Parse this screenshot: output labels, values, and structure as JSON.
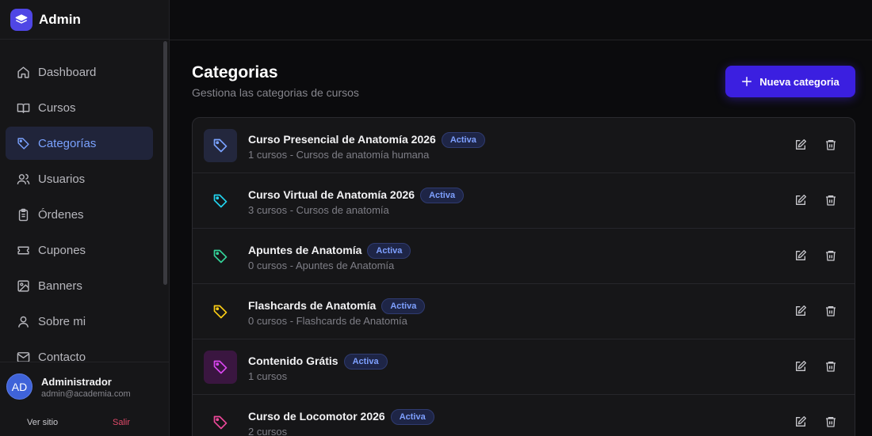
{
  "app": {
    "title": "Admin"
  },
  "sidebar": {
    "items": [
      {
        "label": "Dashboard",
        "icon": "home-icon"
      },
      {
        "label": "Cursos",
        "icon": "book-icon"
      },
      {
        "label": "Categorías",
        "icon": "tag-icon",
        "active": true
      },
      {
        "label": "Usuarios",
        "icon": "users-icon"
      },
      {
        "label": "Órdenes",
        "icon": "clipboard-icon"
      },
      {
        "label": "Cupones",
        "icon": "ticket-icon"
      },
      {
        "label": "Banners",
        "icon": "image-icon"
      },
      {
        "label": "Sobre mi",
        "icon": "user-icon"
      },
      {
        "label": "Contacto",
        "icon": "mail-icon"
      }
    ]
  },
  "user": {
    "initials": "AD",
    "name": "Administrador",
    "email": "admin@academia.com",
    "view_site": "Ver sitio",
    "logout": "Salir"
  },
  "page": {
    "title": "Categorias",
    "subtitle": "Gestiona las categorias de cursos",
    "new_button": "Nueva categoria"
  },
  "colors": {
    "accent": "#3b1fe0",
    "active_text": "#7aa2ff",
    "badge_text": "#7ea0ff",
    "danger": "#e24a6a"
  },
  "categories": [
    {
      "name": "Curso Presencial de Anatomía 2026",
      "status": "Activa",
      "meta": "1 cursos - Cursos de anatomía humana",
      "icon_color": "#7aa2ff",
      "icon_bg": "#23273d"
    },
    {
      "name": "Curso Virtual de Anatomía 2026",
      "status": "Activa",
      "meta": "3 cursos - Cursos de anatomía",
      "icon_color": "#22d3ee",
      "icon_bg": "transparent"
    },
    {
      "name": "Apuntes de Anatomía",
      "status": "Activa",
      "meta": "0 cursos - Apuntes de Anatomía",
      "icon_color": "#34d399",
      "icon_bg": "transparent"
    },
    {
      "name": "Flashcards de Anatomía",
      "status": "Activa",
      "meta": "0 cursos - Flashcards de Anatomía",
      "icon_color": "#facc15",
      "icon_bg": "transparent"
    },
    {
      "name": "Contenido Grátis",
      "status": "Activa",
      "meta": "1 cursos",
      "icon_color": "#d946ef",
      "icon_bg": "#3a1640"
    },
    {
      "name": "Curso de Locomotor 2026",
      "status": "Activa",
      "meta": "2 cursos",
      "icon_color": "#ec4899",
      "icon_bg": "transparent"
    }
  ]
}
